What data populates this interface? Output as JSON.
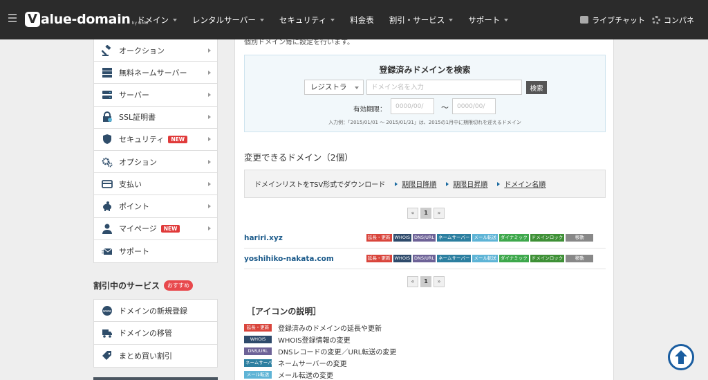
{
  "header": {
    "logo_text": "alue-domain",
    "logo_v": "V",
    "logo_sub": "by GMO",
    "nav": [
      "ドメイン",
      "レンタルサーバー",
      "セキュリティ",
      "料金表",
      "割引・サービス",
      "サポート"
    ],
    "nav_has_caret": [
      true,
      true,
      true,
      false,
      true,
      true
    ],
    "live_chat": "ライブチャット",
    "control_panel": "コンパネ"
  },
  "sidebar": {
    "items": [
      {
        "label": "オークション",
        "icon": "gavel-icon"
      },
      {
        "label": "無料ネームサーバー",
        "icon": "server-stack-icon"
      },
      {
        "label": "サーバー",
        "icon": "server-icon"
      },
      {
        "label": "SSL証明書",
        "icon": "ssl-lock-icon"
      },
      {
        "label": "セキュリティ",
        "icon": "shield-icon",
        "badge": "NEW"
      },
      {
        "label": "オプション",
        "icon": "gears-icon"
      },
      {
        "label": "支払い",
        "icon": "credit-card-icon"
      },
      {
        "label": "ポイント",
        "icon": "piggy-bank-icon"
      },
      {
        "label": "マイページ",
        "icon": "user-icon",
        "badge": "NEW"
      },
      {
        "label": "サポート",
        "icon": "mail-icon"
      }
    ],
    "discount_title": "割引中のサービス",
    "discount_badge": "おすすめ",
    "discount_items": [
      {
        "label": "ドメインの新規登録",
        "icon": "www-icon"
      },
      {
        "label": "ドメインの移管",
        "icon": "truck-icon"
      },
      {
        "label": "まとめ買い割引",
        "icon": "tag-icon"
      }
    ]
  },
  "main": {
    "cut_text": "個別ドメイン毎に設定を行います。",
    "search": {
      "title": "登録済みドメインを検索",
      "registrar_value": "レジストラ",
      "domain_placeholder": "ドメイン名を入力",
      "button": "検索",
      "expiry_label": "有効期限：",
      "date_from_placeholder": "0000/00/",
      "date_to_placeholder": "0000/00/",
      "tilde": "〜",
      "hint": "入力例：「2015/01/01 〜 2015/01/31」は、2015の1月中に期限切れを迎えるドメイン"
    },
    "section_title": "変更できるドメイン（2個）",
    "tsv": {
      "label": "ドメインリストをTSV形式でダウンロード",
      "links": [
        "期限日降順",
        "期限日昇順",
        "ドメイン名順"
      ]
    },
    "pager": {
      "prev": "«",
      "current": "1",
      "next": "»"
    },
    "domains": [
      "hariri.xyz",
      "yoshihiko-nakata.com"
    ],
    "tags": [
      {
        "label": "延長・更新",
        "color": "#d9453c"
      },
      {
        "label": "WHOIS",
        "color": "#2e4a6b"
      },
      {
        "label": "DNS/URL",
        "color": "#6d6297"
      },
      {
        "label": "ネームサーバー",
        "color": "#2c7fa0"
      },
      {
        "label": "メール転送",
        "color": "#5eb4d6"
      },
      {
        "label": "ダイナミック",
        "color": "#3ea84c"
      },
      {
        "label": "ドメインロック",
        "color": "#3e9036"
      },
      {
        "label": "移動",
        "color": "#888888"
      }
    ],
    "legend_title": "［アイコンの説明］",
    "legend": [
      {
        "tag": "延長・更新",
        "text": "登録済みのドメインの延長や更新"
      },
      {
        "tag": "WHOIS",
        "text": "WHOIS登録情報の変更"
      },
      {
        "tag": "DNS/URL",
        "text": "DNSレコードの変更／URL転送の変更"
      },
      {
        "tag": "ネームサーバー",
        "text": "ネームサーバーの変更"
      },
      {
        "tag": "メール転送",
        "text": "メール転送の変更"
      }
    ]
  },
  "colors": {
    "header_bg": "#2b2b2b",
    "link": "#1b5a8a",
    "accent_blue": "#1a5da0",
    "new_badge": "#e03a3a"
  }
}
